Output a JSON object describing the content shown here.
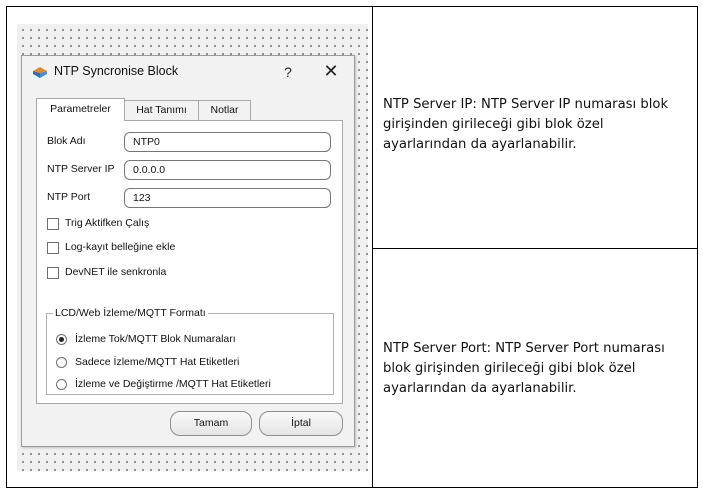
{
  "dialog": {
    "title": "NTP Syncronise Block",
    "help_label": "?",
    "close_label": "✕",
    "tabs": [
      {
        "label": "Parametreler",
        "active": true
      },
      {
        "label": "Hat Tanımı",
        "active": false
      },
      {
        "label": "Notlar",
        "active": false
      }
    ],
    "fields": {
      "block_name": {
        "label": "Blok Adı",
        "value": "NTP0"
      },
      "server_ip": {
        "label": "NTP Server IP",
        "value": "0.0.0.0"
      },
      "port": {
        "label": "NTP Port",
        "value": "123"
      }
    },
    "checkboxes": [
      {
        "label": "Trig Aktifken Çalış",
        "checked": false
      },
      {
        "label": "Log-kayıt belleğine ekle",
        "checked": false
      },
      {
        "label": "DevNET ile senkronla",
        "checked": false
      }
    ],
    "group": {
      "title": "LCD/Web İzleme/MQTT Formatı",
      "options": [
        {
          "label": "İzleme Tok/MQTT Blok Numaraları",
          "checked": true
        },
        {
          "label": "Sadece İzleme/MQTT Hat Etiketleri",
          "checked": false
        },
        {
          "label": "İzleme ve Değiştirme /MQTT Hat Etiketleri",
          "checked": false
        }
      ]
    },
    "buttons": {
      "ok": "Tamam",
      "cancel": "İptal"
    },
    "icon": "block-app-icon"
  },
  "descriptions": {
    "server_ip": "NTP Server IP: NTP Server IP numarası blok girişinden girileceği gibi blok özel ayarlarından da ayarlanabilir.",
    "server_port": "NTP Server Port: NTP Server Port numarası blok girişinden girileceği gibi blok özel ayarlarından da ayarlanabilir."
  },
  "colors": {
    "icon_orange": "#e8862a",
    "icon_blue": "#2f6fb3"
  }
}
